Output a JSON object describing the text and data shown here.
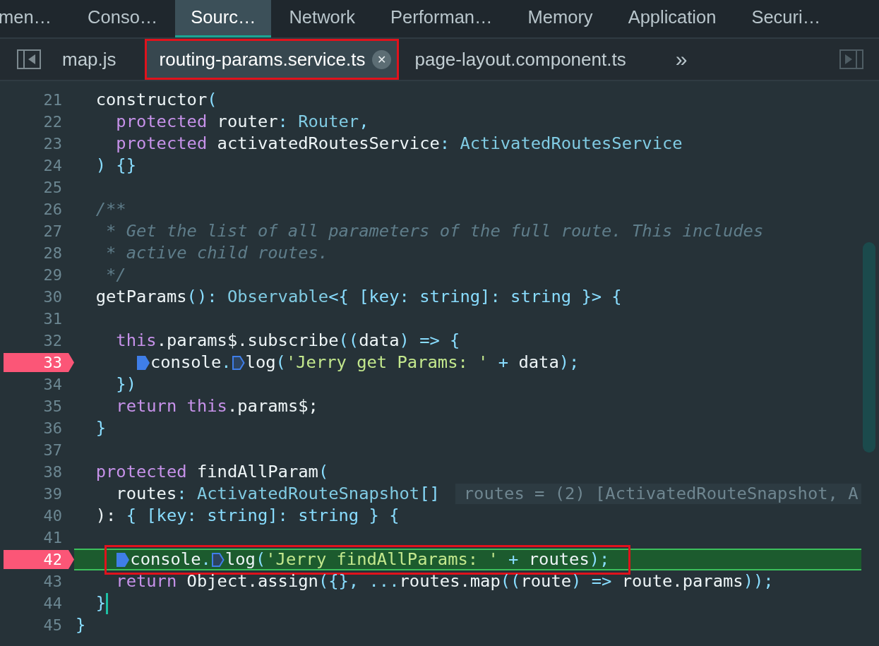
{
  "panel_tabs": [
    {
      "label": "men…",
      "selected": false
    },
    {
      "label": "Conso…",
      "selected": false
    },
    {
      "label": "Sourc…",
      "selected": true
    },
    {
      "label": "Network",
      "selected": false
    },
    {
      "label": "Performan…",
      "selected": false
    },
    {
      "label": "Memory",
      "selected": false
    },
    {
      "label": "Application",
      "selected": false
    },
    {
      "label": "Securi…",
      "selected": false
    }
  ],
  "file_tabs": [
    {
      "label": "map.js",
      "selected": false
    },
    {
      "label": "routing-params.service.ts",
      "selected": true,
      "closable": true,
      "framed": true
    },
    {
      "label": "page-layout.component.ts",
      "selected": false
    }
  ],
  "more_tabs": "»",
  "close_glyph": "✕",
  "lines": [
    {
      "n": "21",
      "breakpoint": false,
      "current": false,
      "tokens": [
        {
          "kind": "id",
          "text": "  constructor"
        },
        {
          "kind": "pu",
          "text": "("
        }
      ]
    },
    {
      "n": "22",
      "breakpoint": false,
      "current": false,
      "tokens": [
        {
          "kind": "kw",
          "text": "    protected"
        },
        {
          "kind": "id",
          "text": " router"
        },
        {
          "kind": "pu",
          "text": ":"
        },
        {
          "kind": "ty",
          "text": " Router"
        },
        {
          "kind": "pu",
          "text": ","
        }
      ]
    },
    {
      "n": "23",
      "breakpoint": false,
      "current": false,
      "tokens": [
        {
          "kind": "kw",
          "text": "    protected"
        },
        {
          "kind": "id",
          "text": " activatedRoutesService"
        },
        {
          "kind": "pu",
          "text": ":"
        },
        {
          "kind": "ty",
          "text": " ActivatedRoutesService"
        }
      ]
    },
    {
      "n": "24",
      "breakpoint": false,
      "current": false,
      "tokens": [
        {
          "kind": "pu",
          "text": "  ) {}"
        }
      ]
    },
    {
      "n": "25",
      "breakpoint": false,
      "current": false
    },
    {
      "n": "26",
      "breakpoint": false,
      "current": false,
      "tokens": [
        {
          "kind": "cm",
          "text": "  /**"
        }
      ]
    },
    {
      "n": "27",
      "breakpoint": false,
      "current": false,
      "tokens": [
        {
          "kind": "cm",
          "text": "   * Get the list of all parameters of the full route. This includes"
        }
      ]
    },
    {
      "n": "28",
      "breakpoint": false,
      "current": false,
      "tokens": [
        {
          "kind": "cm",
          "text": "   * active child routes."
        }
      ]
    },
    {
      "n": "29",
      "breakpoint": false,
      "current": false,
      "tokens": [
        {
          "kind": "cm",
          "text": "   */"
        }
      ]
    },
    {
      "n": "30",
      "breakpoint": false,
      "current": false,
      "tokens": [
        {
          "kind": "id",
          "text": "  getParams"
        },
        {
          "kind": "pu",
          "text": "():"
        },
        {
          "kind": "ty",
          "text": " Observable"
        },
        {
          "kind": "pu",
          "text": "<{ [key: string]: string }> {"
        }
      ]
    },
    {
      "n": "31",
      "breakpoint": false,
      "current": false
    },
    {
      "n": "32",
      "breakpoint": false,
      "current": false,
      "tokens": [
        {
          "kind": "kw",
          "text": "    this"
        },
        {
          "kind": "id",
          "text": ".params$.subscribe"
        },
        {
          "kind": "pu",
          "text": "(("
        },
        {
          "kind": "id",
          "text": "data"
        },
        {
          "kind": "pu",
          "text": ") => {"
        }
      ]
    },
    {
      "n": "33",
      "breakpoint": true,
      "current": false,
      "tokens": [
        {
          "kind": "id",
          "text": "      console",
          "marker_active": true
        },
        {
          "kind": "pu",
          "text": "."
        },
        {
          "kind": "id",
          "text": "log",
          "marker_active": false
        },
        {
          "kind": "pu",
          "text": "("
        },
        {
          "kind": "st",
          "text": "'Jerry get Params: '"
        },
        {
          "kind": "pu",
          "text": " + "
        },
        {
          "kind": "id",
          "text": "data"
        },
        {
          "kind": "pu",
          "text": ");"
        }
      ]
    },
    {
      "n": "34",
      "breakpoint": false,
      "current": false,
      "tokens": [
        {
          "kind": "pu",
          "text": "    })"
        }
      ]
    },
    {
      "n": "35",
      "breakpoint": false,
      "current": false,
      "tokens": [
        {
          "kind": "kw",
          "text": "    return this"
        },
        {
          "kind": "id",
          "text": ".params$;"
        }
      ]
    },
    {
      "n": "36",
      "breakpoint": false,
      "current": false,
      "tokens": [
        {
          "kind": "pu",
          "text": "  }"
        }
      ]
    },
    {
      "n": "37",
      "breakpoint": false,
      "current": false
    },
    {
      "n": "38",
      "breakpoint": false,
      "current": false,
      "tokens": [
        {
          "kind": "kw",
          "text": "  protected"
        },
        {
          "kind": "id",
          "text": " findAllParam"
        },
        {
          "kind": "pu",
          "text": "("
        }
      ]
    },
    {
      "n": "39",
      "breakpoint": false,
      "current": false,
      "tokens": [
        {
          "kind": "id",
          "text": "    routes"
        },
        {
          "kind": "pu",
          "text": ":"
        },
        {
          "kind": "ty",
          "text": " ActivatedRouteSnapshot"
        },
        {
          "kind": "pu",
          "text": "[]"
        }
      ],
      "inline_value": "routes = (2) [ActivatedRouteSnapshot, A"
    },
    {
      "n": "40",
      "breakpoint": false,
      "current": false,
      "tokens": [
        {
          "kind": "id",
          "text": "  ):"
        },
        {
          "kind": "pu",
          "text": " { [key: string]: string } {"
        }
      ]
    },
    {
      "n": "41",
      "breakpoint": false,
      "current": false
    },
    {
      "n": "42",
      "breakpoint": true,
      "current": true,
      "framed": true,
      "tokens": [
        {
          "kind": "id",
          "text": "    console",
          "marker_active": true
        },
        {
          "kind": "pu",
          "text": "."
        },
        {
          "kind": "id",
          "text": "log",
          "marker_active": false
        },
        {
          "kind": "pu",
          "text": "("
        },
        {
          "kind": "st",
          "text": "'Jerry findAllParams: '"
        },
        {
          "kind": "pu",
          "text": " + "
        },
        {
          "kind": "id",
          "text": "routes"
        },
        {
          "kind": "pu",
          "text": ");"
        }
      ]
    },
    {
      "n": "43",
      "breakpoint": false,
      "current": false,
      "tokens": [
        {
          "kind": "kw",
          "text": "    return"
        },
        {
          "kind": "id",
          "text": " Object.assign"
        },
        {
          "kind": "pu",
          "text": "({}, ..."
        },
        {
          "kind": "id",
          "text": "routes.map"
        },
        {
          "kind": "pu",
          "text": "(("
        },
        {
          "kind": "id",
          "text": "route"
        },
        {
          "kind": "pu",
          "text": ") => "
        },
        {
          "kind": "id",
          "text": "route.params"
        },
        {
          "kind": "pu",
          "text": "));"
        }
      ]
    },
    {
      "n": "44",
      "breakpoint": false,
      "current": false,
      "cursor": true,
      "tokens": [
        {
          "kind": "pu",
          "text": "  }"
        }
      ]
    },
    {
      "n": "45",
      "breakpoint": false,
      "current": false,
      "tokens": [
        {
          "kind": "pu",
          "text": "}"
        }
      ]
    }
  ]
}
